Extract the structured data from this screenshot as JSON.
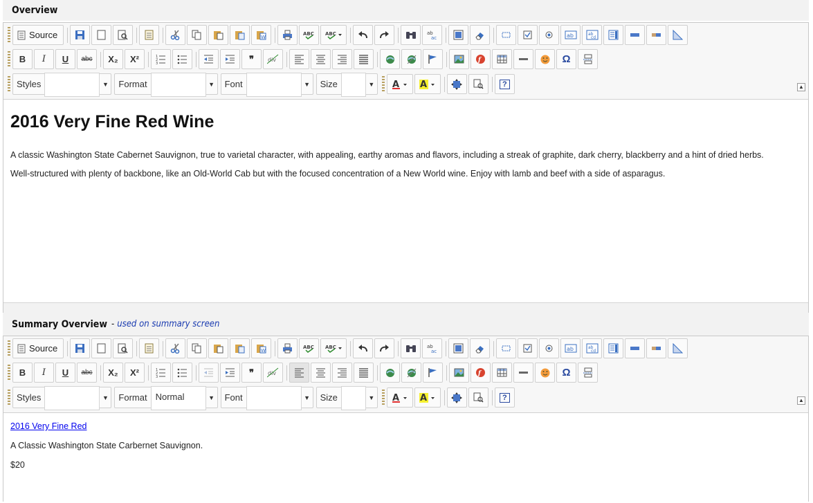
{
  "overview": {
    "header": "Overview",
    "toolbar": {
      "source_label": "Source",
      "styles_label": "Styles",
      "styles_value": "",
      "format_label": "Format",
      "format_value": "",
      "font_label": "Font",
      "font_value": "",
      "size_label": "Size",
      "size_value": ""
    },
    "heading": "2016 Very Fine Red Wine",
    "paragraphs": [
      "A classic Washington State Cabernet Sauvignon, true to varietal character, with appealing, earthy aromas and flavors, including a streak of graphite, dark cherry, blackberry and a hint of dried herbs.",
      "Well-structured with plenty of backbone, like an Old-World Cab but with the focused concentration of a New World wine. Enjoy with lamb and beef with a side of asparagus."
    ]
  },
  "summary": {
    "header": "Summary Overview",
    "hint": "used on summary screen",
    "dash": "-",
    "toolbar": {
      "source_label": "Source",
      "styles_label": "Styles",
      "styles_value": "",
      "format_label": "Format",
      "format_value": "Normal",
      "font_label": "Font",
      "font_value": "",
      "size_label": "Size",
      "size_value": ""
    },
    "link_text": "2016 Very Fine Red",
    "tagline": "A Classic Washington State Carbernet Sauvignon.",
    "price": "$20"
  },
  "icons": {
    "bold": "B",
    "italic": "I",
    "underline": "U",
    "strike": "abc",
    "subscript": "X₂",
    "superscript": "X²",
    "blockquote": "❞",
    "omega": "Ω",
    "help": "?",
    "collapse": "▲",
    "dropdown": "▼"
  }
}
